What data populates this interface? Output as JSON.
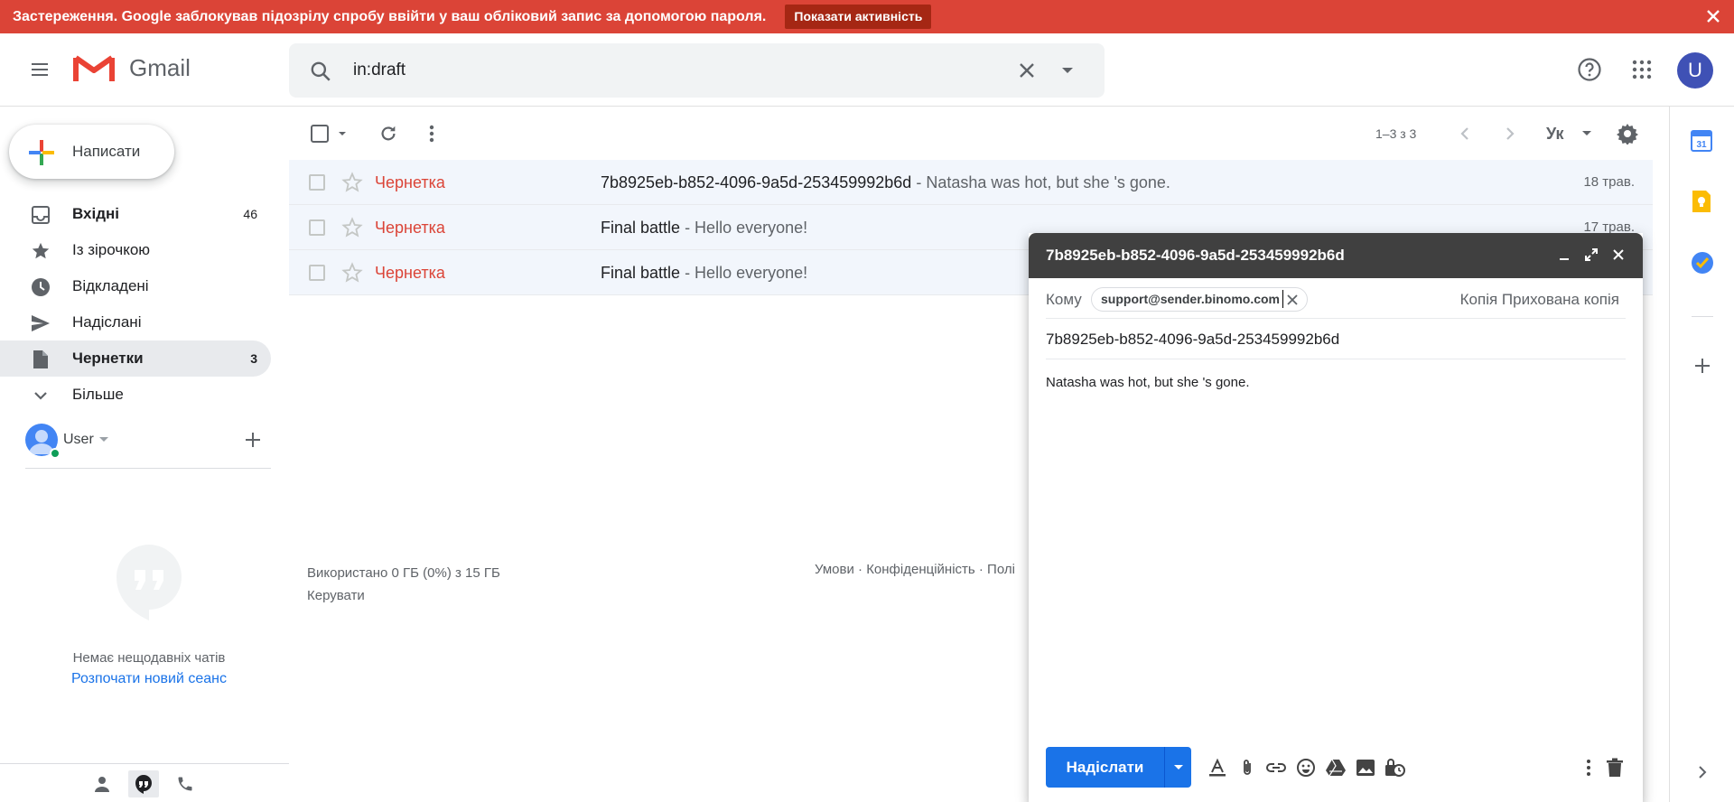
{
  "warning": {
    "text": "Застереження. Google заблокував підозрілу спробу ввійти у ваш обліковий запис за допомогою пароля.",
    "button": "Показати активність"
  },
  "header": {
    "app_name": "Gmail",
    "search_value": "in:draft",
    "avatar_letter": "U"
  },
  "compose_button": "Написати",
  "nav": [
    {
      "label": "Вхідні",
      "count": "46",
      "bold": true,
      "icon": "inbox-icon"
    },
    {
      "label": "Із зірочкою",
      "count": "",
      "icon": "star-icon"
    },
    {
      "label": "Відкладені",
      "count": "",
      "icon": "clock-icon"
    },
    {
      "label": "Надіслані",
      "count": "",
      "icon": "send-icon"
    },
    {
      "label": "Чернетки",
      "count": "3",
      "bold": true,
      "active": true,
      "icon": "draft-icon"
    },
    {
      "label": "Більше",
      "count": "",
      "icon": "chevron-down-icon"
    }
  ],
  "hangouts": {
    "user": "User",
    "no_chats": "Немає нещодавніх чатів",
    "new_session": "Розпочати новий сеанс"
  },
  "toolbar": {
    "pager": "1–3 з 3",
    "lang": "Ук"
  },
  "messages": [
    {
      "sender": "Чернетка",
      "subject": "7b8925eb-b852-4096-9a5d-253459992b6d",
      "snippet": " - Natasha was hot, but she 's gone.",
      "date": "18 трав."
    },
    {
      "sender": "Чернетка",
      "subject": "Final battle",
      "snippet": " - Hello everyone!",
      "date": "17 трав."
    },
    {
      "sender": "Чернетка",
      "subject": "Final battle",
      "snippet": " - Hello everyone!",
      "date": ""
    }
  ],
  "footer": {
    "storage": "Використано 0 ГБ (0%) з 15 ГБ",
    "manage": "Керувати",
    "links": "Умови · Конфіденційність · Полі"
  },
  "compose_window": {
    "title": "7b8925eb-b852-4096-9a5d-253459992b6d",
    "to_label": "Кому",
    "recipient": "support@sender.binomo.com",
    "cc_bcc": "Копія Прихована копія",
    "subject": "7b8925eb-b852-4096-9a5d-253459992b6d",
    "body": "Natasha was hot, but she 's gone.",
    "send_label": "Надіслати"
  },
  "colors": {
    "warning_bg": "#db4437",
    "draft_red": "#db4437",
    "send_blue": "#1a73e8"
  }
}
